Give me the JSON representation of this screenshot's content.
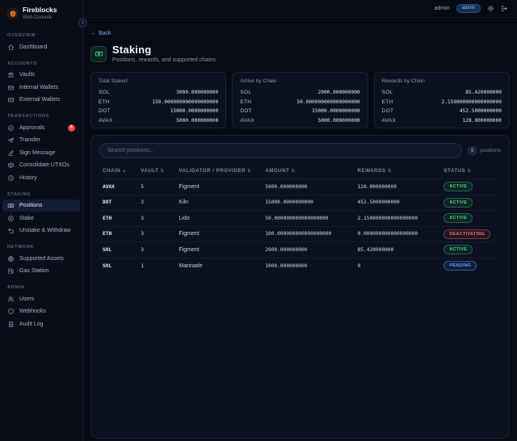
{
  "topbar": {
    "brand": {
      "name": "Fireblocks",
      "subtitle": "Web Console"
    },
    "user": {
      "name": "admin",
      "role_badge": "admin"
    }
  },
  "sidebar": {
    "sections": [
      {
        "label": "OVERVIEW",
        "items": [
          {
            "label": "Dashboard",
            "icon": "home-icon"
          }
        ]
      },
      {
        "label": "ACCOUNTS",
        "items": [
          {
            "label": "Vaults",
            "icon": "bank-icon"
          },
          {
            "label": "Internal Wallets",
            "icon": "wallet-icon"
          },
          {
            "label": "External Wallets",
            "icon": "wallet-icon"
          }
        ]
      },
      {
        "label": "TRANSACTIONS",
        "items": [
          {
            "label": "Approvals",
            "icon": "check-circle-icon",
            "badge": "6"
          },
          {
            "label": "Transfer",
            "icon": "send-icon"
          },
          {
            "label": "Sign Message",
            "icon": "edit-icon"
          },
          {
            "label": "Consolidate UTXOs",
            "icon": "box-icon"
          },
          {
            "label": "History",
            "icon": "history-icon"
          }
        ]
      },
      {
        "label": "STAKING",
        "items": [
          {
            "label": "Positions",
            "icon": "banknote-icon",
            "active": true
          },
          {
            "label": "Stake",
            "icon": "target-icon"
          },
          {
            "label": "Unstake & Withdraw",
            "icon": "undo-icon"
          }
        ]
      },
      {
        "label": "NETWORK",
        "items": [
          {
            "label": "Supported Assets",
            "icon": "globe-icon"
          },
          {
            "label": "Gas Station",
            "icon": "fuel-icon"
          }
        ]
      },
      {
        "label": "ADMIN",
        "items": [
          {
            "label": "Users",
            "icon": "users-icon"
          },
          {
            "label": "Webhooks",
            "icon": "shield-icon"
          },
          {
            "label": "Audit Log",
            "icon": "document-icon"
          }
        ]
      }
    ]
  },
  "page": {
    "back_label": "Back",
    "back_arrow": "←",
    "title": "Staking",
    "subtitle": "Positions, rewards, and supported chains"
  },
  "summary_cards": [
    {
      "title": "Total Staked",
      "rows": [
        {
          "label": "SOL",
          "value": "3000.000000000"
        },
        {
          "label": "ETH",
          "value": "150.000000000000000000"
        },
        {
          "label": "DOT",
          "value": "15000.0000000000"
        },
        {
          "label": "AVAX",
          "value": "5000.000000000"
        }
      ]
    },
    {
      "title": "Active by Chain",
      "rows": [
        {
          "label": "SOL",
          "value": "2000.000000000"
        },
        {
          "label": "ETH",
          "value": "50.000000000000000000"
        },
        {
          "label": "DOT",
          "value": "15000.0000000000"
        },
        {
          "label": "AVAX",
          "value": "5000.000000000"
        }
      ]
    },
    {
      "title": "Rewards by Chain",
      "rows": [
        {
          "label": "SOL",
          "value": "85.420000000"
        },
        {
          "label": "ETH",
          "value": "2.150000000000000000"
        },
        {
          "label": "DOT",
          "value": "452.5000000000"
        },
        {
          "label": "AVAX",
          "value": "128.000000000"
        }
      ]
    }
  ],
  "positions": {
    "search_placeholder": "Search positions...",
    "count": "6",
    "count_label": "positions",
    "columns": [
      {
        "label": "CHAIN",
        "sort": "▲"
      },
      {
        "label": "VAULT",
        "sort": "⇅"
      },
      {
        "label": "VALIDATOR / PROVIDER",
        "sort": "⇅"
      },
      {
        "label": "AMOUNT",
        "sort": "⇅"
      },
      {
        "label": "REWARDS",
        "sort": "⇅"
      },
      {
        "label": "STATUS",
        "sort": "⇅"
      }
    ],
    "rows": [
      {
        "chain": "AVAX",
        "vault": "5",
        "validator": "Figment",
        "amount": "5000.000000000",
        "rewards": "128.000000000",
        "status": "ACTIVE"
      },
      {
        "chain": "DOT",
        "vault": "3",
        "validator": "Kiln",
        "amount": "15000.0000000000",
        "rewards": "452.5000000000",
        "status": "ACTIVE"
      },
      {
        "chain": "ETH",
        "vault": "3",
        "validator": "Lido",
        "amount": "50.000000000000000000",
        "rewards": "2.150000000000000000",
        "status": "ACTIVE"
      },
      {
        "chain": "ETH",
        "vault": "3",
        "validator": "Figment",
        "amount": "100.000000000000000000",
        "rewards": "0.000000000000000000",
        "status": "DEACTIVATING"
      },
      {
        "chain": "SOL",
        "vault": "3",
        "validator": "Figment",
        "amount": "2000.000000000",
        "rewards": "85.420000000",
        "status": "ACTIVE"
      },
      {
        "chain": "SOL",
        "vault": "1",
        "validator": "Marinade",
        "amount": "1000.000000000",
        "rewards": "0",
        "status": "PENDING"
      }
    ]
  },
  "colors": {
    "background": "#070b14",
    "panel": "#0c1120",
    "border": "#1a2336",
    "brand_orange": "#f97316",
    "accent_blue": "#60a5fa",
    "active_green": "#4ade80",
    "deactivating_red": "#f87171",
    "pending_blue": "#60a5fa",
    "approvals_badge_red": "#ef4444"
  }
}
